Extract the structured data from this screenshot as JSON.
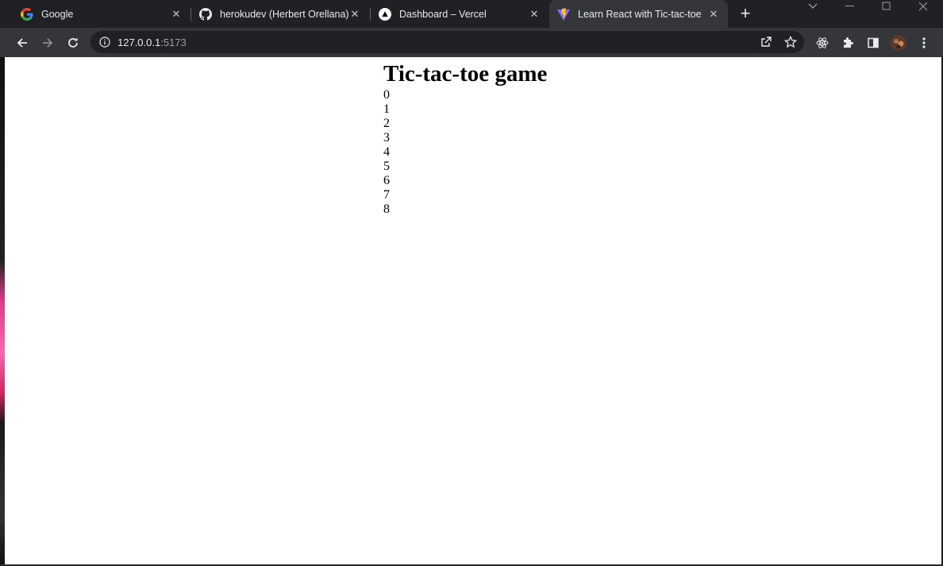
{
  "browser": {
    "tabs": [
      {
        "title": "Google",
        "favicon": "google-icon",
        "active": false
      },
      {
        "title": "herokudev (Herbert Orellana)",
        "favicon": "github-icon",
        "active": false
      },
      {
        "title": "Dashboard – Vercel",
        "favicon": "vercel-icon",
        "active": false
      },
      {
        "title": "Learn React with Tic-tac-toe",
        "favicon": "vite-icon",
        "active": true
      }
    ],
    "address": {
      "host": "127.0.0.1",
      "port": ":5173"
    },
    "colors": {
      "tabstrip": "#202124",
      "toolbar": "#35363a",
      "omnibox": "#202124",
      "text": "#e8eaed"
    }
  },
  "page": {
    "heading": "Tic-tac-toe game",
    "squares": [
      "0",
      "1",
      "2",
      "3",
      "4",
      "5",
      "6",
      "7",
      "8"
    ]
  }
}
